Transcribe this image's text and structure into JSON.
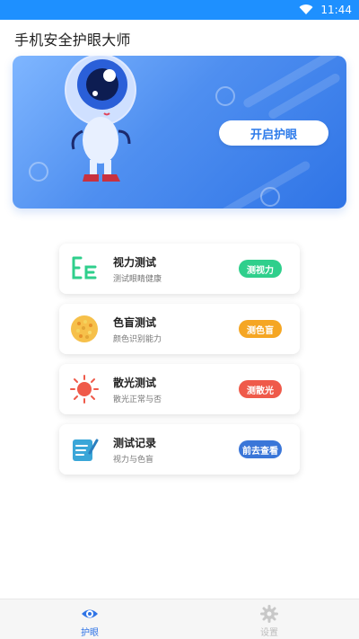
{
  "status_bar": {
    "time": "11:44"
  },
  "app": {
    "title": "手机安全护眼大师"
  },
  "banner": {
    "start_button": "开启护眼"
  },
  "cards": [
    {
      "title": "视力测试",
      "subtitle": "测试眼睛健康",
      "action": "测视力",
      "icon": "eye-chart-icon",
      "accent": "#2fcf8c"
    },
    {
      "title": "色盲测试",
      "subtitle": "颜色识别能力",
      "action": "测色盲",
      "icon": "color-dots-icon",
      "accent": "#f5a623"
    },
    {
      "title": "散光测试",
      "subtitle": "散光正常与否",
      "action": "测散光",
      "icon": "sunburst-icon",
      "accent": "#ef5a4a"
    },
    {
      "title": "测试记录",
      "subtitle": "视力与色盲",
      "action": "前去查看",
      "icon": "record-edit-icon",
      "accent": "#3a76d8"
    }
  ],
  "tabs": [
    {
      "label": "护眼",
      "icon": "eye-icon",
      "active": true
    },
    {
      "label": "设置",
      "icon": "gear-icon",
      "active": false
    }
  ]
}
